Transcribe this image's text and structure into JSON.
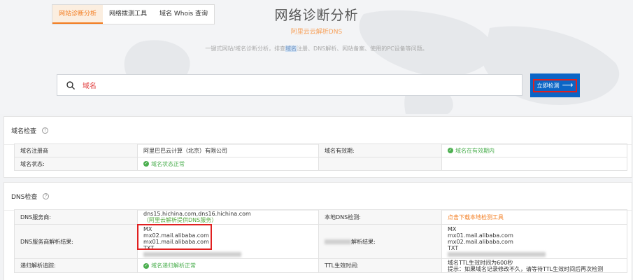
{
  "tabs": [
    {
      "label": "网站诊断分析",
      "active": true
    },
    {
      "label": "网络拨测工具",
      "active": false
    },
    {
      "label": "域名 Whois 查询",
      "active": false
    }
  ],
  "header": {
    "title": "网络诊断分析",
    "subtitle": "阿里云云解析DNS",
    "desc_before": "一键式网站/域名诊断分析，排查",
    "desc_highlight": "域名",
    "desc_after": "注册、DNS解析、网站备案、使用的PC设备等问题。"
  },
  "search": {
    "value": "域名",
    "button": "立即检测",
    "arrow": "⟶"
  },
  "domain_check": {
    "title": "域名检查",
    "help": "?",
    "rows": [
      {
        "k1": "域名注册商",
        "v1": "阿里巴巴云计算（北京）有限公司",
        "k2": "域名有效期:",
        "v2": "域名在有效期内"
      },
      {
        "k1": "域名状态:",
        "v1": "域名状态正常",
        "k2": "",
        "v2": ""
      }
    ]
  },
  "dns_check": {
    "title": "DNS检查",
    "help": "?",
    "server_label": "DNS服务商:",
    "servers": "dns15.hichina.com,dns16.hichina.com",
    "server_note": "（阿里云解析提供DNS服务）",
    "local_label": "本地DNS检测:",
    "local_value": "点击下载本地检测工具",
    "result_label": "DNS服务商解析结果:",
    "result_lines": [
      "MX",
      "mx02.mail.alibaba.com",
      "mx01.mail.alibaba.com",
      "TXT"
    ],
    "resolve_label_suffix": "解析结果:",
    "resolve_lines": [
      "MX",
      "mx01.mail.alibaba.com",
      "mx02.mail.alibaba.com",
      "TXT"
    ],
    "reverse_label": "递归解析追踪:",
    "reverse_value": "域名递归解析正常",
    "ttl_label": "TTL生效时间:",
    "ttl_line1": "域名TTL生效时间为600秒",
    "ttl_line2": "提示：如果域名记录修改不久，请等待TTL生效时间后再次检测"
  },
  "colors": {
    "accent": "#f37b1d",
    "primary": "#0b65c6",
    "ok": "#4caf50",
    "highlight": "#e02020"
  }
}
